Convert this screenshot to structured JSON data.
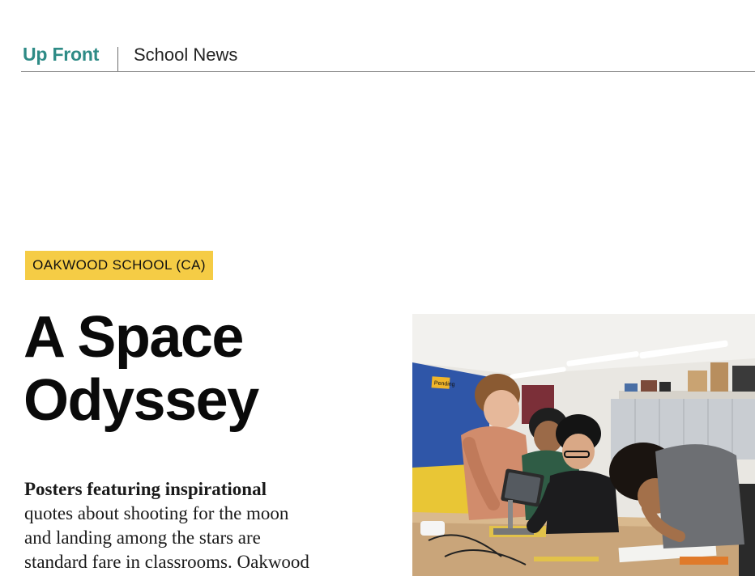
{
  "header": {
    "section": "Up Front",
    "subsection": "School News"
  },
  "article": {
    "kicker": "OAKWOOD SCHOOL (CA)",
    "headline_line1": "A Space",
    "headline_line2": "Odyssey",
    "body_lead": "Posters featuring inspirational",
    "body_rest": "quotes about shooting for the moon\nand landing among the stars are\nstandard fare in classrooms. Oakwood"
  },
  "photo": {
    "description_icon": "photo-icon",
    "wall_sign": "Pending"
  },
  "colors": {
    "accent_teal": "#2e8b86",
    "kicker_yellow": "#f5cc45",
    "rule_gray": "#8a8a8a"
  }
}
